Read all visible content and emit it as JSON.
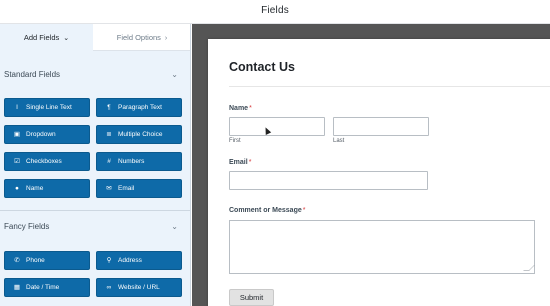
{
  "app": {
    "title": "Fields"
  },
  "sidebar": {
    "tabs": [
      {
        "label": "Add Fields"
      },
      {
        "label": "Field Options"
      }
    ],
    "standard": {
      "heading": "Standard Fields",
      "buttons": [
        {
          "label": "Single Line Text",
          "icon": "text-cursor-icon",
          "glyph": "I"
        },
        {
          "label": "Paragraph Text",
          "icon": "paragraph-icon",
          "glyph": "¶"
        },
        {
          "label": "Dropdown",
          "icon": "dropdown-icon",
          "glyph": "▣"
        },
        {
          "label": "Multiple Choice",
          "icon": "list-icon",
          "glyph": "≣"
        },
        {
          "label": "Checkboxes",
          "icon": "checkbox-icon",
          "glyph": "☑"
        },
        {
          "label": "Numbers",
          "icon": "hash-icon",
          "glyph": "#"
        },
        {
          "label": "Name",
          "icon": "user-icon",
          "glyph": "●"
        },
        {
          "label": "Email",
          "icon": "envelope-icon",
          "glyph": "✉"
        }
      ]
    },
    "fancy": {
      "heading": "Fancy Fields",
      "buttons": [
        {
          "label": "Phone",
          "icon": "phone-icon",
          "glyph": "✆"
        },
        {
          "label": "Address",
          "icon": "map-pin-icon",
          "glyph": "⚲"
        },
        {
          "label": "Date / Time",
          "icon": "calendar-icon",
          "glyph": "▦"
        },
        {
          "label": "Website / URL",
          "icon": "link-icon",
          "glyph": "∞"
        }
      ]
    }
  },
  "form": {
    "title": "Contact Us",
    "name_label": "Name",
    "required_mark": "*",
    "first_sublabel": "First",
    "last_sublabel": "Last",
    "email_label": "Email",
    "message_label": "Comment or Message",
    "submit_label": "Submit"
  },
  "colors": {
    "button_blue": "#0e6aa8",
    "sidebar_bg": "#ebf3fb",
    "canvas_bg": "#555555",
    "required_red": "#d63638"
  }
}
